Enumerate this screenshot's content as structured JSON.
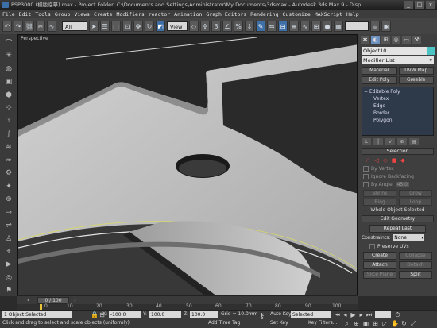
{
  "window": {
    "title": "PSP3000 (横版临摹).max   - Project Folder: C:\\Documents and Settings\\Administrator\\My Documents\\3dsmax   - Autodesk 3ds Max 9   - Disp",
    "buttons": [
      "_",
      "□",
      "x"
    ]
  },
  "menu": [
    "File",
    "Edit",
    "Tools",
    "Group",
    "Views",
    "Create",
    "Modifiers",
    "reactor",
    "Animation",
    "Graph Editors",
    "Rendering",
    "Customize",
    "MAXScript",
    "Help"
  ],
  "toolbar": {
    "filter_select": "All",
    "refcoord_select": "View"
  },
  "viewport": {
    "label": "Perspective",
    "colors": {
      "surface": "#b9b9b9",
      "background": "#262626",
      "edge": "#d8d86a"
    }
  },
  "panel": {
    "object_name": "Object10",
    "object_color": "#4dc4c4",
    "modifier_list": "Modifier List",
    "buttons": [
      "Material",
      "UVW Map",
      "Edit Poly",
      "Greeble"
    ],
    "stack": [
      {
        "label": "Editable Poly",
        "level": 0
      },
      {
        "label": "Vertex",
        "level": 1
      },
      {
        "label": "Edge",
        "level": 1
      },
      {
        "label": "Border",
        "level": 1
      },
      {
        "label": "Polygon",
        "level": 1
      }
    ],
    "selection": {
      "title": "Selection",
      "checkboxes": [
        "By Vertex",
        "Ignore Backfacing",
        "By Angle:"
      ],
      "angle_value": "45.0",
      "row1": [
        "Shrink",
        "Grow"
      ],
      "row2": [
        "Ring",
        "Loop"
      ],
      "status": "Whole Object Selected"
    },
    "edit_geometry": {
      "title": "Edit Geometry",
      "repeat_last": "Repeat Last",
      "constraints_label": "Constraints:",
      "constraints_value": "None",
      "preserve_uvs": "Preserve UVs",
      "create": "Create",
      "collapse": "Collapse",
      "attach": "Attach",
      "detach": "Detach",
      "slice_plane": "Slice Plane",
      "split": "Split"
    }
  },
  "timeslider": {
    "position": "0 / 100",
    "ticks": [
      "0",
      "10",
      "20",
      "30",
      "40",
      "50",
      "60",
      "70",
      "80",
      "90",
      "100"
    ]
  },
  "status": {
    "selection_count": "1 Object Selected",
    "prompt": "Click and drag to select and scale objects (uniformly)",
    "x_label": "X:",
    "x_value": "-100.0",
    "y_label": "Y:",
    "y_value": "100.0",
    "z_label": "Z:",
    "z_value": "100.0",
    "grid": "Grid = 10.0mm",
    "add_time_tag": "Add Time Tag",
    "auto_key": "Auto Key",
    "auto_key_value": "Selected",
    "set_key": "Set Key",
    "key_filters": "Key Filters..."
  }
}
